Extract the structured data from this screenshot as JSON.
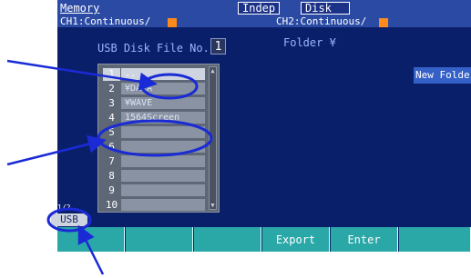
{
  "header": {
    "menu_title": "Memory",
    "mode_tag": "Indep",
    "device_tag": "Disk",
    "ch1_label": "CH1:Continuous/",
    "ch2_label": "CH2:Continuous/"
  },
  "file_panel": {
    "file_no_label": "USB Disk File No.",
    "file_no_value": "1",
    "folder_label": "Folder ¥",
    "new_folder_label": "New Folder"
  },
  "list": [
    {
      "num": "1",
      "name": "..",
      "selected": true
    },
    {
      "num": "2",
      "name": "¥DATA",
      "selected": false
    },
    {
      "num": "3",
      "name": "¥WAVE",
      "selected": false
    },
    {
      "num": "4",
      "name": "1564Screen",
      "selected": false
    },
    {
      "num": "5",
      "name": "",
      "selected": false
    },
    {
      "num": "6",
      "name": "",
      "selected": false
    },
    {
      "num": "7",
      "name": "",
      "selected": false
    },
    {
      "num": "8",
      "name": "",
      "selected": false
    },
    {
      "num": "9",
      "name": "",
      "selected": false
    },
    {
      "num": "10",
      "name": "",
      "selected": false
    }
  ],
  "usb_label": "USB",
  "usb_indicator": "1/2",
  "softkeys": [
    "",
    "",
    "",
    "Export",
    "Enter",
    ""
  ],
  "colors": {
    "screen_bg": "#0a1f6a",
    "softkey_bg": "#2aa7a7",
    "annotation": "#1a2bd6",
    "ch_marker": "#ff8a1c"
  }
}
